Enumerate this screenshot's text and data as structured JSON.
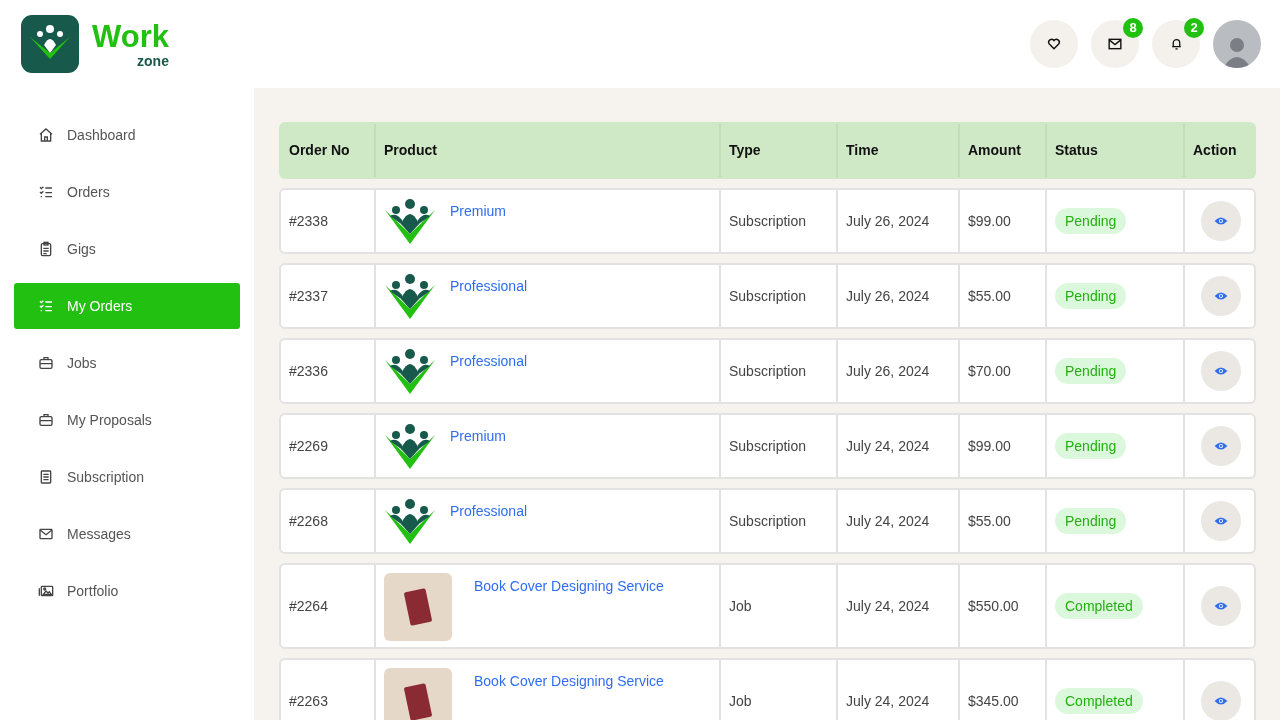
{
  "brand": {
    "name": "Work",
    "sub": "zone"
  },
  "header": {
    "actions": [
      {
        "kind": "heart"
      },
      {
        "kind": "mail",
        "badge": "8"
      },
      {
        "kind": "bell",
        "badge": "2"
      }
    ]
  },
  "sidebar": {
    "items": [
      {
        "label": "Dashboard",
        "kind": "home",
        "selected": false
      },
      {
        "label": "Orders",
        "kind": "list",
        "selected": false
      },
      {
        "label": "Gigs",
        "kind": "clipboard",
        "selected": false
      },
      {
        "label": "My Orders",
        "kind": "list",
        "selected": true
      },
      {
        "label": "Jobs",
        "kind": "briefcase",
        "selected": false
      },
      {
        "label": "My Proposals",
        "kind": "briefcase",
        "selected": false
      },
      {
        "label": "Subscription",
        "kind": "doc",
        "selected": false
      },
      {
        "label": "Messages",
        "kind": "mail",
        "selected": false
      },
      {
        "label": "Portfolio",
        "kind": "image",
        "selected": false
      }
    ]
  },
  "table": {
    "columns": [
      "Order No",
      "Product",
      "Type",
      "Time",
      "Amount",
      "Status",
      "Action"
    ],
    "rows": [
      {
        "order": "#2338",
        "product": "Premium",
        "kind": "logo",
        "type": "Subscription",
        "time": "July 26, 2024",
        "amount": "$99.00",
        "status": "Pending"
      },
      {
        "order": "#2337",
        "product": "Professional",
        "kind": "logo",
        "type": "Subscription",
        "time": "July 26, 2024",
        "amount": "$55.00",
        "status": "Pending"
      },
      {
        "order": "#2336",
        "product": "Professional",
        "kind": "logo",
        "type": "Subscription",
        "time": "July 26, 2024",
        "amount": "$70.00",
        "status": "Pending"
      },
      {
        "order": "#2269",
        "product": "Premium",
        "kind": "logo",
        "type": "Subscription",
        "time": "July 24, 2024",
        "amount": "$99.00",
        "status": "Pending"
      },
      {
        "order": "#2268",
        "product": "Professional",
        "kind": "logo",
        "type": "Subscription",
        "time": "July 24, 2024",
        "amount": "$55.00",
        "status": "Pending"
      },
      {
        "order": "#2264",
        "product": "Book Cover Designing Service",
        "kind": "photo",
        "type": "Job",
        "time": "July 24, 2024",
        "amount": "$550.00",
        "status": "Completed"
      },
      {
        "order": "#2263",
        "product": "Book Cover Designing Service",
        "kind": "photo",
        "type": "Job",
        "time": "July 24, 2024",
        "amount": "$345.00",
        "status": "Completed"
      }
    ]
  }
}
